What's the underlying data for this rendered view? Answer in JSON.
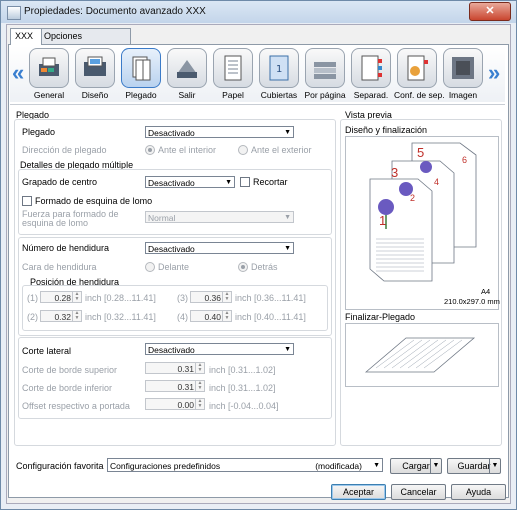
{
  "window": {
    "title": "Propiedades: Documento avanzado XXX",
    "close": "✕"
  },
  "tabs": [
    {
      "label": "XXX"
    },
    {
      "label": "Opciones avanzadas"
    }
  ],
  "toolbar": {
    "items": [
      {
        "label": "General",
        "icon": "printer-icon"
      },
      {
        "label": "Diseño",
        "icon": "layout-icon"
      },
      {
        "label": "Plegado",
        "icon": "fold-icon"
      },
      {
        "label": "Salir",
        "icon": "output-icon"
      },
      {
        "label": "Papel",
        "icon": "paper-icon"
      },
      {
        "label": "Cubiertas",
        "icon": "cover-icon"
      },
      {
        "label": "Por página",
        "icon": "per-page-icon"
      },
      {
        "label": "Separad.",
        "icon": "separator-icon"
      },
      {
        "label": "Conf. de sep.",
        "icon": "separator-settings-icon"
      },
      {
        "label": "Imagen",
        "icon": "image-icon"
      }
    ]
  },
  "plegado": {
    "section_title": "Plegado",
    "plegado_label": "Plegado",
    "plegado_value": "Desactivado",
    "direccion_label": "Dirección de plegado",
    "direccion_opt1": "Ante el interior",
    "direccion_opt2": "Ante el exterior",
    "detalles_title": "Detalles de plegado múltiple",
    "grapado_label": "Grapado de centro",
    "grapado_value": "Desactivado",
    "recortar_label": "Recortar",
    "formado_label": "Formado de esquina de lomo",
    "fuerza_label": "Fuerza para formado de esquina de lomo",
    "fuerza_line1": "Fuerza para formado de",
    "fuerza_line2": "esquina de lomo",
    "fuerza_value": "Normal"
  },
  "hendidura": {
    "numero_label": "Número de hendidura",
    "numero_value": "Desactivado",
    "cara_label": "Cara de hendidura",
    "cara_opt1": "Delante",
    "cara_opt2": "Detrás",
    "posicion_title": "Posición de hendidura",
    "positions": [
      {
        "idx": "(1)",
        "value": "0.28",
        "range": "inch [0.28...11.41]"
      },
      {
        "idx": "(2)",
        "value": "0.32",
        "range": "inch [0.32...11.41]"
      },
      {
        "idx": "(3)",
        "value": "0.36",
        "range": "inch [0.36...11.41]"
      },
      {
        "idx": "(4)",
        "value": "0.40",
        "range": "inch [0.40...11.41]"
      }
    ]
  },
  "corte": {
    "lateral_label": "Corte lateral",
    "lateral_value": "Desactivado",
    "superior_label": "Corte de borde superior",
    "superior_value": "0.31",
    "superior_range": "inch [0.31...1.02]",
    "inferior_label": "Corte de borde inferior",
    "inferior_value": "0.31",
    "inferior_range": "inch [0.31...1.02]",
    "offset_label": "Offset respectivo a portada",
    "offset_value": "0.00",
    "offset_range": "inch [-0.04...0.04]"
  },
  "preview": {
    "title": "Vista previa",
    "design_label": "Diseño y finalización",
    "paper_size": "A4",
    "paper_dims": "210.0x297.0 mm",
    "finish_label": "Finalizar-Plegado",
    "page_numbers": [
      "1",
      "2",
      "3",
      "4",
      "5",
      "6"
    ]
  },
  "favorite": {
    "label": "Configuración favorita",
    "value": "Configuraciones predefinidos",
    "modified": "(modificada)",
    "cargar": "Cargar",
    "guardar": "Guardar"
  },
  "buttons": {
    "aceptar": "Aceptar",
    "cancelar": "Cancelar",
    "ayuda": "Ayuda"
  }
}
